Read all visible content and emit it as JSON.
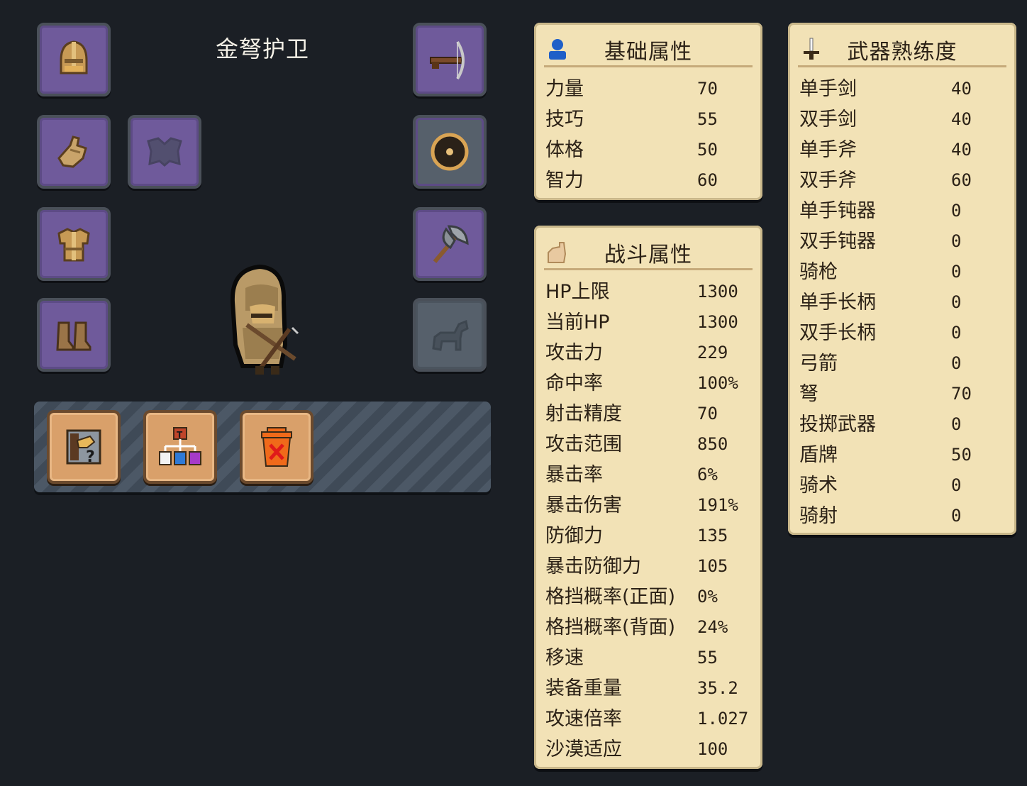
{
  "unit": {
    "name": "金弩护卫"
  },
  "equipment": {
    "left": [
      {
        "slot": "helmet",
        "icon": "golden-helmet-icon",
        "filled": true
      },
      {
        "slot": "gloves",
        "icon": "glove-icon",
        "filled": true
      },
      {
        "slot": "armor",
        "icon": "golden-armor-icon",
        "filled": true
      },
      {
        "slot": "boots",
        "icon": "boots-icon",
        "filled": true
      }
    ],
    "cape": {
      "slot": "cape",
      "icon": "cape-icon",
      "filled": false
    },
    "right": [
      {
        "slot": "main-weapon",
        "icon": "crossbow-icon",
        "filled": true
      },
      {
        "slot": "shield",
        "icon": "round-shield-icon",
        "filled": true
      },
      {
        "slot": "secondary-weapon",
        "icon": "battle-axe-icon",
        "filled": true
      },
      {
        "slot": "mount",
        "icon": "horse-icon",
        "filled": false
      }
    ]
  },
  "actions": [
    {
      "name": "unit-info",
      "icon": "unit-info-icon"
    },
    {
      "name": "upgrade-tree",
      "icon": "upgrade-tree-icon"
    },
    {
      "name": "dismiss",
      "icon": "trash-can-icon"
    }
  ],
  "basic_stats": {
    "title": "基础属性",
    "rows": [
      {
        "label": "力量",
        "value": "70"
      },
      {
        "label": "技巧",
        "value": "55"
      },
      {
        "label": "体格",
        "value": "50"
      },
      {
        "label": "智力",
        "value": "60"
      }
    ]
  },
  "combat_stats": {
    "title": "战斗属性",
    "rows": [
      {
        "label": "HP上限",
        "value": "1300"
      },
      {
        "label": "当前HP",
        "value": "1300"
      },
      {
        "label": "攻击力",
        "value": "229"
      },
      {
        "label": "命中率",
        "value": "100%"
      },
      {
        "label": "射击精度",
        "value": "70"
      },
      {
        "label": "攻击范围",
        "value": "850"
      },
      {
        "label": "暴击率",
        "value": "6%"
      },
      {
        "label": "暴击伤害",
        "value": "191%"
      },
      {
        "label": "防御力",
        "value": "135"
      },
      {
        "label": "暴击防御力",
        "value": "105"
      },
      {
        "label": "格挡概率(正面)",
        "value": "0%"
      },
      {
        "label": "格挡概率(背面)",
        "value": "24%"
      },
      {
        "label": "移速",
        "value": "55"
      },
      {
        "label": "装备重量",
        "value": "35.2"
      },
      {
        "label": "攻速倍率",
        "value": "1.027"
      },
      {
        "label": "沙漠适应",
        "value": "100"
      }
    ]
  },
  "weapon_proficiency": {
    "title": "武器熟练度",
    "rows": [
      {
        "label": "单手剑",
        "value": "40"
      },
      {
        "label": "双手剑",
        "value": "40"
      },
      {
        "label": "单手斧",
        "value": "40"
      },
      {
        "label": "双手斧",
        "value": "60"
      },
      {
        "label": "单手钝器",
        "value": "0"
      },
      {
        "label": "双手钝器",
        "value": "0"
      },
      {
        "label": "骑枪",
        "value": "0"
      },
      {
        "label": "单手长柄",
        "value": "0"
      },
      {
        "label": "双手长柄",
        "value": "0"
      },
      {
        "label": "弓箭",
        "value": "0"
      },
      {
        "label": "弩",
        "value": "70"
      },
      {
        "label": "投掷武器",
        "value": "0"
      },
      {
        "label": "盾牌",
        "value": "50"
      },
      {
        "label": "骑术",
        "value": "0"
      },
      {
        "label": "骑射",
        "value": "0"
      }
    ]
  },
  "colors": {
    "background": "#1b1f25",
    "panel": "#f2e2b6",
    "slot_filled": "#6f5a9b",
    "slot_empty": "#56606b",
    "action_button": "#d9a06a"
  }
}
